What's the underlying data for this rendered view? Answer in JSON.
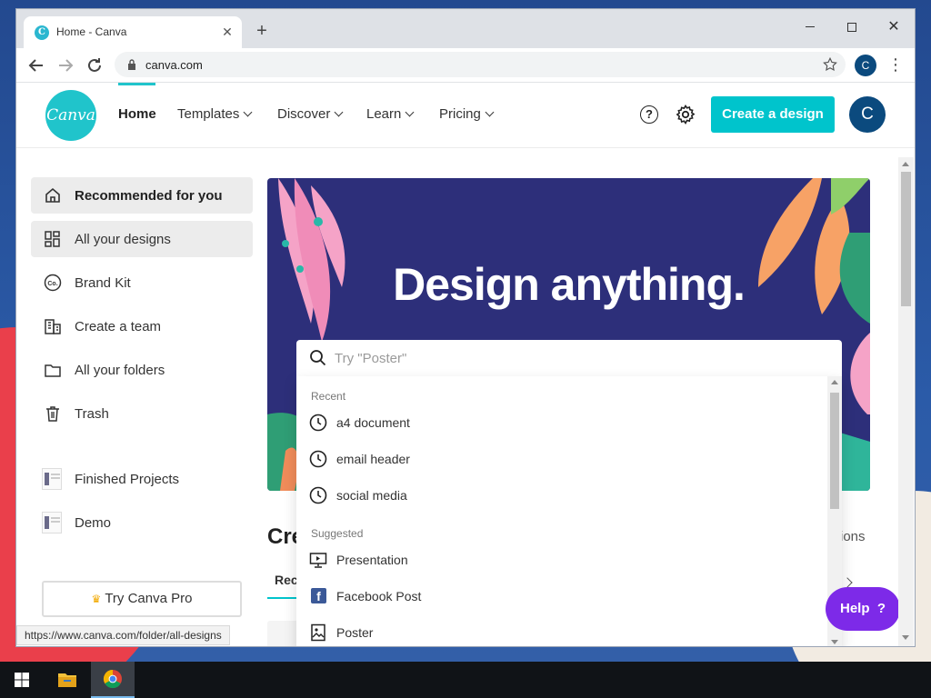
{
  "browser": {
    "tab_title": "Home - Canva",
    "tab_favicon_letter": "C",
    "url": "canva.com",
    "profile_initial": "C",
    "status_url": "https://www.canva.com/folder/all-designs"
  },
  "header": {
    "logo_text": "Canva",
    "nav": [
      {
        "label": "Home"
      },
      {
        "label": "Templates"
      },
      {
        "label": "Discover"
      },
      {
        "label": "Learn"
      },
      {
        "label": "Pricing"
      }
    ],
    "help_glyph": "?",
    "create_label": "Create a design",
    "avatar_initial": "C"
  },
  "sidebar": {
    "items": [
      {
        "label": "Recommended for you",
        "icon": "home-icon"
      },
      {
        "label": "All your designs",
        "icon": "grid-icon"
      },
      {
        "label": "Brand Kit",
        "icon": "brand-kit-icon"
      },
      {
        "label": "Create a team",
        "icon": "building-icon"
      },
      {
        "label": "All your folders",
        "icon": "folder-icon"
      },
      {
        "label": "Trash",
        "icon": "trash-icon"
      }
    ],
    "folders": [
      {
        "label": "Finished Projects"
      },
      {
        "label": "Demo"
      }
    ],
    "try_pro_label": "Try Canva Pro"
  },
  "banner": {
    "title": "Design anything."
  },
  "search": {
    "placeholder": "Try \"Poster\"",
    "recent_heading": "Recent",
    "recent": [
      "a4 document",
      "email header",
      "social media"
    ],
    "suggested_heading": "Suggested",
    "suggested": [
      {
        "label": "Presentation",
        "icon": "presentation-icon"
      },
      {
        "label": "Facebook Post",
        "icon": "facebook-icon"
      },
      {
        "label": "Poster",
        "icon": "poster-icon"
      }
    ]
  },
  "section": {
    "title_visible": "Cre",
    "tab_visible": "Rec",
    "more_visible": "ions"
  },
  "help_button": {
    "label": "Help",
    "glyph": "?"
  },
  "colors": {
    "accent": "#00c4cc",
    "help": "#7d2ae8",
    "banner_bg": "#2d2f7a",
    "avatar": "#0b4a7e"
  }
}
